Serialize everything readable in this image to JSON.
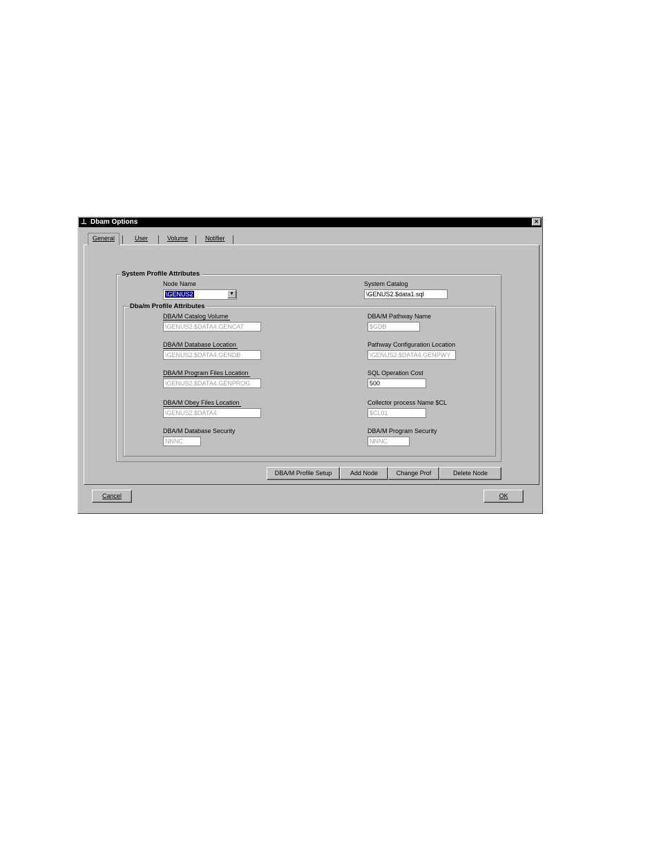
{
  "window": {
    "title": "Dbam Options",
    "close_glyph": "×",
    "app_icon": "dbam-icon",
    "title_icon_glyph": "⊥"
  },
  "tabs": [
    {
      "label": "General",
      "active": true
    },
    {
      "label": "User",
      "active": false
    },
    {
      "label": "Volume",
      "active": false
    },
    {
      "label": "Notifier",
      "active": false
    }
  ],
  "system_profile": {
    "legend": "System Profile Attributes",
    "node_name_label": "Node Name",
    "node_name_value": "\\GENUS2",
    "system_catalog_label": "System Catalog",
    "system_catalog_value": "\\GENUS2.$data1.sql"
  },
  "dbam_profile": {
    "legend": "Dba/m Profile Attributes",
    "catalog_volume_label": "DBA/M Catalog Volume",
    "catalog_volume_value": "\\GENUS2.$DATA4.GENCAT",
    "pathway_name_label": "DBA/M Pathway Name",
    "pathway_name_value": "$GDB",
    "database_location_label": "DBA/M Database Location",
    "database_location_value": "\\GENUS2.$DATA4.GENDB",
    "pathway_config_label": "Pathway Configuration Location",
    "pathway_config_value": "\\GENUS2.$DATA4.GENPWY",
    "program_files_label": "DBA/M Program Files Location",
    "program_files_value": "\\GENUS2.$DATA4.GENPROG",
    "sql_cost_label": "SQL Operation Cost",
    "sql_cost_value": "500",
    "obey_files_label": "DBA/M Obey Files Location",
    "obey_files_value": "\\GENUS2.$DATA4",
    "collector_label": "Collector process Name $CL",
    "collector_value": "$CL01",
    "db_security_label": "DBA/M Database Security",
    "db_security_value": "NNNC",
    "program_security_label": "DBA/M Program Security",
    "program_security_value": "NNNC"
  },
  "buttons": {
    "profile_setup": "DBA/M Profile Setup",
    "add_node": "Add Node",
    "change_prof": "Change Prof",
    "delete_node": "Delete Node",
    "cancel": "Cancel",
    "ok": "OK"
  },
  "combo_arrow_glyph": "▼"
}
